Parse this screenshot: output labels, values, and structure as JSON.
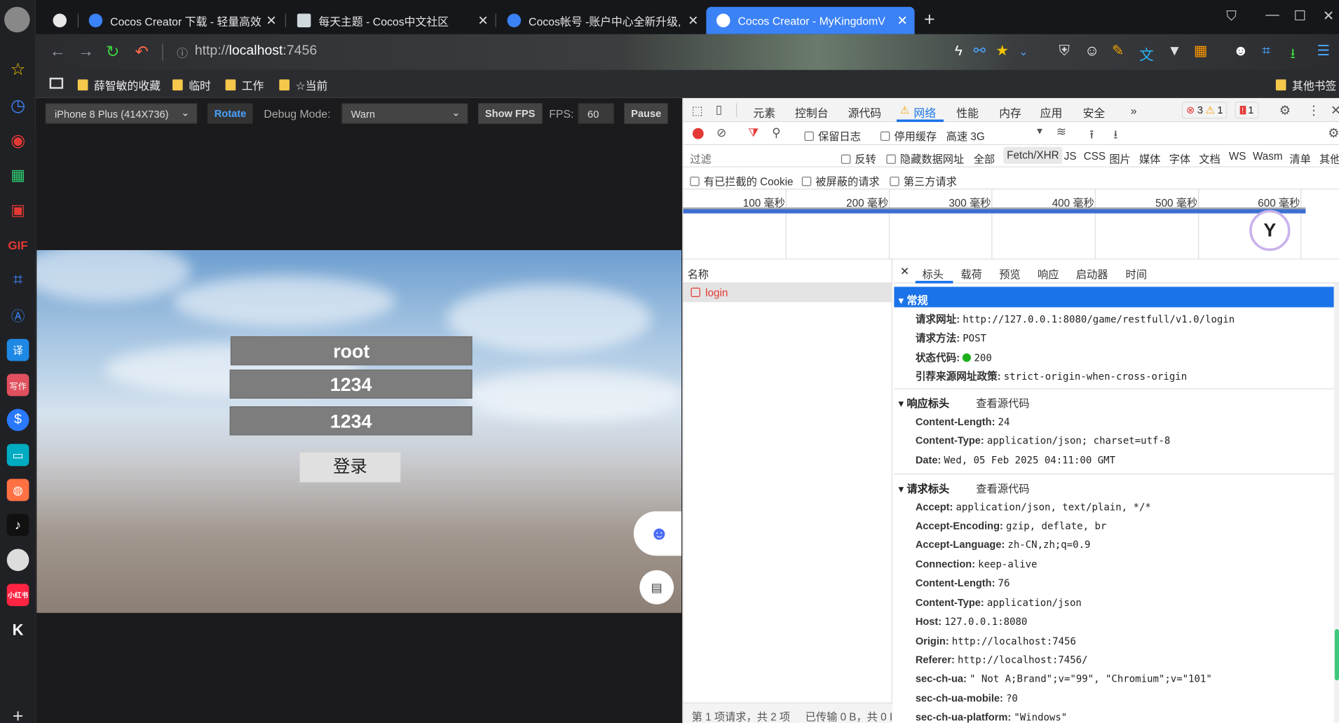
{
  "tabs": [
    {
      "title": "",
      "active": false
    },
    {
      "title": "Cocos Creator 下载 - 轻量高效",
      "active": false
    },
    {
      "title": "每天主题 - Cocos中文社区",
      "active": false
    },
    {
      "title": "Cocos帐号 -账户中心全新升级,",
      "active": false
    },
    {
      "title": "Cocos Creator - MyKingdomV",
      "active": true
    }
  ],
  "address": {
    "scheme": "http://",
    "host": "localhost",
    "port": ":7456"
  },
  "bookmarks": [
    "薛智敏的收藏",
    "临时",
    "工作",
    "☆当前"
  ],
  "bookmarks_other": "其他书签",
  "rail_labels": {
    "gif": "GIF",
    "translate": "译",
    "write": "写作",
    "xhs": "小红书",
    "k": "K"
  },
  "game_toolbar": {
    "device": "iPhone 8 Plus (414X736)",
    "rotate": "Rotate",
    "debug_label": "Debug Mode:",
    "debug_value": "Warn",
    "show_fps": "Show FPS",
    "fps_label": "FPS:",
    "fps_value": "60",
    "pause": "Pause"
  },
  "game": {
    "username": "root",
    "password": "1234",
    "confirm": "1234",
    "login": "登录"
  },
  "devtools": {
    "tabs": [
      "元素",
      "控制台",
      "源代码",
      "网络",
      "性能",
      "内存",
      "应用",
      "安全",
      "»"
    ],
    "errors": "3",
    "warnings": "1",
    "issues": "1",
    "toolbar": {
      "preserve_log": "保留日志",
      "disable_cache": "停用缓存",
      "throttle": "高速 3G"
    },
    "filter": {
      "placeholder": "过滤",
      "invert": "反转",
      "hide_data": "隐藏数据网址",
      "types": [
        "全部",
        "Fetch/XHR",
        "JS",
        "CSS",
        "图片",
        "媒体",
        "字体",
        "文档",
        "WS",
        "Wasm",
        "清单",
        "其他"
      ]
    },
    "filter2": [
      "有已拦截的 Cookie",
      "被屏蔽的请求",
      "第三方请求"
    ],
    "timeline": [
      "100 毫秒",
      "200 毫秒",
      "300 毫秒",
      "400 毫秒",
      "500 毫秒",
      "600 毫秒"
    ],
    "name_header": "名称",
    "requests": [
      "login"
    ],
    "detail_tabs": [
      "标头",
      "载荷",
      "预览",
      "响应",
      "启动器",
      "时间"
    ],
    "general": {
      "title": "常规",
      "items": [
        {
          "k": "请求网址:",
          "v": "http://127.0.0.1:8080/game/restfull/v1.0/login"
        },
        {
          "k": "请求方法:",
          "v": "POST"
        },
        {
          "k": "状态代码:",
          "v": "200"
        },
        {
          "k": "引荐来源网址政策:",
          "v": "strict-origin-when-cross-origin"
        }
      ]
    },
    "view_source": "查看源代码",
    "response_headers": {
      "title": "响应标头",
      "items": [
        {
          "k": "Content-Length:",
          "v": "24"
        },
        {
          "k": "Content-Type:",
          "v": "application/json; charset=utf-8"
        },
        {
          "k": "Date:",
          "v": "Wed, 05 Feb 2025 04:11:00 GMT"
        }
      ]
    },
    "request_headers": {
      "title": "请求标头",
      "items": [
        {
          "k": "Accept:",
          "v": "application/json, text/plain, */*"
        },
        {
          "k": "Accept-Encoding:",
          "v": "gzip, deflate, br"
        },
        {
          "k": "Accept-Language:",
          "v": "zh-CN,zh;q=0.9"
        },
        {
          "k": "Connection:",
          "v": "keep-alive"
        },
        {
          "k": "Content-Length:",
          "v": "76"
        },
        {
          "k": "Content-Type:",
          "v": "application/json"
        },
        {
          "k": "Host:",
          "v": "127.0.0.1:8080"
        },
        {
          "k": "Origin:",
          "v": "http://localhost:7456"
        },
        {
          "k": "Referer:",
          "v": "http://localhost:7456/"
        },
        {
          "k": "sec-ch-ua:",
          "v": "\" Not A;Brand\";v=\"99\", \"Chromium\";v=\"101\""
        },
        {
          "k": "sec-ch-ua-mobile:",
          "v": "?0"
        },
        {
          "k": "sec-ch-ua-platform:",
          "v": "\"Windows\""
        }
      ]
    },
    "status_bar": [
      "第 1 项请求，共 2 项",
      "已传输 0 B，共 0 I"
    ]
  },
  "colors": {
    "accent": "#3b82f6",
    "tab_active": "#3b82f6",
    "record": "#e53935",
    "status_ok": "#1db01d"
  }
}
